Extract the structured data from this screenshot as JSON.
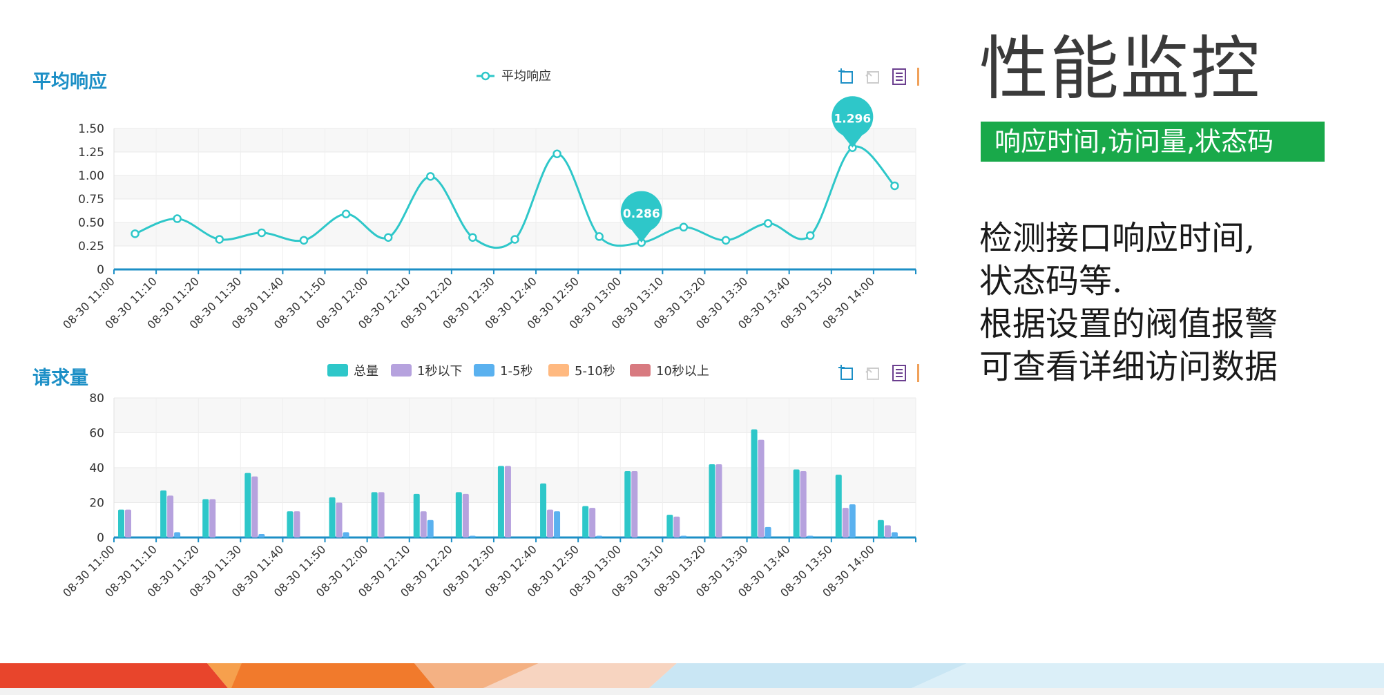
{
  "slide": {
    "title": "性能监控",
    "subtitle": "响应时间,访问量,状态码",
    "description": [
      "检测接口响应时间,",
      "状态码等.",
      "根据设置的阀值报警",
      "可查看详细访问数据"
    ]
  },
  "colors": {
    "line": "#2ec7c9",
    "total": "#2ec7c9",
    "under_1s": "#b6a2de",
    "s1_5": "#5ab1ef",
    "s5_10": "#ffb980",
    "over_10s": "#d87a80",
    "axis": "#1c8fc6",
    "subtitle_bg": "#19a94a"
  },
  "toolbox_icons": [
    "data-zoom-icon",
    "data-zoom-reset-icon",
    "data-view-icon"
  ],
  "chart_data": [
    {
      "type": "line",
      "title": "平均响应",
      "legend": [
        "平均响应"
      ],
      "legend_position": "top-center",
      "categories": [
        "08-30 11:00",
        "08-30 11:10",
        "08-30 11:20",
        "08-30 11:30",
        "08-30 11:40",
        "08-30 11:50",
        "08-30 12:00",
        "08-30 12:10",
        "08-30 12:20",
        "08-30 12:30",
        "08-30 12:40",
        "08-30 12:50",
        "08-30 13:00",
        "08-30 13:10",
        "08-30 13:20",
        "08-30 13:30",
        "08-30 13:40",
        "08-30 13:50",
        "08-30 14:00"
      ],
      "series": [
        {
          "name": "平均响应",
          "values": [
            0.38,
            0.54,
            0.32,
            0.39,
            0.31,
            0.59,
            0.34,
            0.99,
            0.34,
            0.32,
            1.23,
            0.35,
            0.286,
            0.45,
            0.31,
            0.49,
            0.36,
            1.296,
            0.89
          ]
        }
      ],
      "markers": [
        {
          "index": 12,
          "label": "0.286"
        },
        {
          "index": 17,
          "label": "1.296"
        }
      ],
      "ylim": [
        0,
        1.5
      ],
      "yticks": [
        "0",
        "0.25",
        "0.50",
        "0.75",
        "1.00",
        "1.25",
        "1.50"
      ],
      "grid": true
    },
    {
      "type": "bar",
      "title": "请求量",
      "legend": [
        "总量",
        "1秒以下",
        "1-5秒",
        "5-10秒",
        "10秒以上"
      ],
      "legend_position": "top-center",
      "categories": [
        "08-30 11:00",
        "08-30 11:10",
        "08-30 11:20",
        "08-30 11:30",
        "08-30 11:40",
        "08-30 11:50",
        "08-30 12:00",
        "08-30 12:10",
        "08-30 12:20",
        "08-30 12:30",
        "08-30 12:40",
        "08-30 12:50",
        "08-30 13:00",
        "08-30 13:10",
        "08-30 13:20",
        "08-30 13:30",
        "08-30 13:40",
        "08-30 13:50",
        "08-30 14:00"
      ],
      "series": [
        {
          "name": "总量",
          "values": [
            16,
            27,
            22,
            37,
            15,
            23,
            26,
            25,
            26,
            41,
            31,
            18,
            38,
            13,
            42,
            62,
            39,
            36,
            10
          ]
        },
        {
          "name": "1秒以下",
          "values": [
            16,
            24,
            22,
            35,
            15,
            20,
            26,
            15,
            25,
            41,
            16,
            17,
            38,
            12,
            42,
            56,
            38,
            17,
            7
          ]
        },
        {
          "name": "1-5秒",
          "values": [
            0,
            3,
            0,
            2,
            0,
            3,
            0,
            10,
            1,
            0,
            15,
            1,
            0,
            1,
            0,
            6,
            1,
            19,
            3
          ]
        },
        {
          "name": "5-10秒",
          "values": [
            0,
            0,
            0,
            0,
            0,
            0,
            0,
            0,
            0,
            0,
            0,
            0,
            0,
            0,
            0,
            0,
            0,
            0,
            0
          ]
        },
        {
          "name": "10秒以上",
          "values": [
            0,
            0,
            0,
            0,
            0,
            0,
            0,
            0,
            0,
            0,
            0,
            0,
            0,
            0,
            0,
            0,
            0,
            0,
            0
          ]
        }
      ],
      "ylim": [
        0,
        80
      ],
      "yticks": [
        "0",
        "20",
        "40",
        "60",
        "80"
      ],
      "grid": true
    }
  ]
}
